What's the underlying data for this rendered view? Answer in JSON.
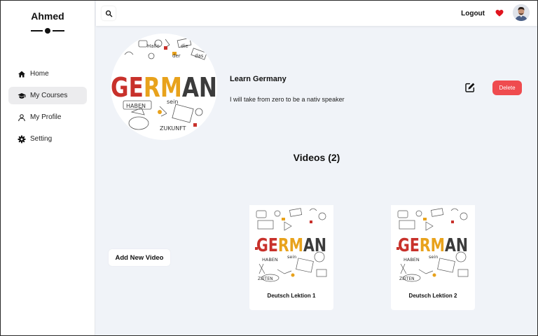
{
  "sidebar": {
    "brand": "Ahmed",
    "items": [
      {
        "label": "Home",
        "icon": "home-icon",
        "active": false
      },
      {
        "label": "My Courses",
        "icon": "graduation-cap-icon",
        "active": true
      },
      {
        "label": "My Profile",
        "icon": "user-icon",
        "active": false
      },
      {
        "label": "Setting",
        "icon": "gear-icon",
        "active": false
      }
    ]
  },
  "topbar": {
    "search_icon": "search-icon",
    "logout_label": "Logout",
    "heart_icon": "heart-icon",
    "heart_color": "#e0141e"
  },
  "course": {
    "image_words": {
      "title": "GERMAN",
      "w1": "HABEN",
      "w2": "sein",
      "w3": "ZUKUNFT",
      "w4": "der",
      "w5": "die",
      "w6": "das",
      "w7": "Hallo"
    },
    "title": "Learn Germany",
    "description": "I will take from zero to be a nativ speaker",
    "edit_icon": "edit-icon",
    "delete_label": "Delete",
    "delete_color": "#ef4b4f"
  },
  "videos": {
    "heading": "Videos (2)",
    "add_label": "Add New Video",
    "thumb_words": {
      "title": "GERMAN",
      "w1": "HABEN",
      "w2": "sein",
      "w3": "ZEITEN"
    },
    "items": [
      {
        "title": "Deutsch Lektion 1"
      },
      {
        "title": "Deutsch Lektion 2"
      }
    ]
  },
  "colors": {
    "german_red": "#c8312b",
    "german_yellow": "#e8a21c",
    "german_dark": "#3b3b3b"
  }
}
